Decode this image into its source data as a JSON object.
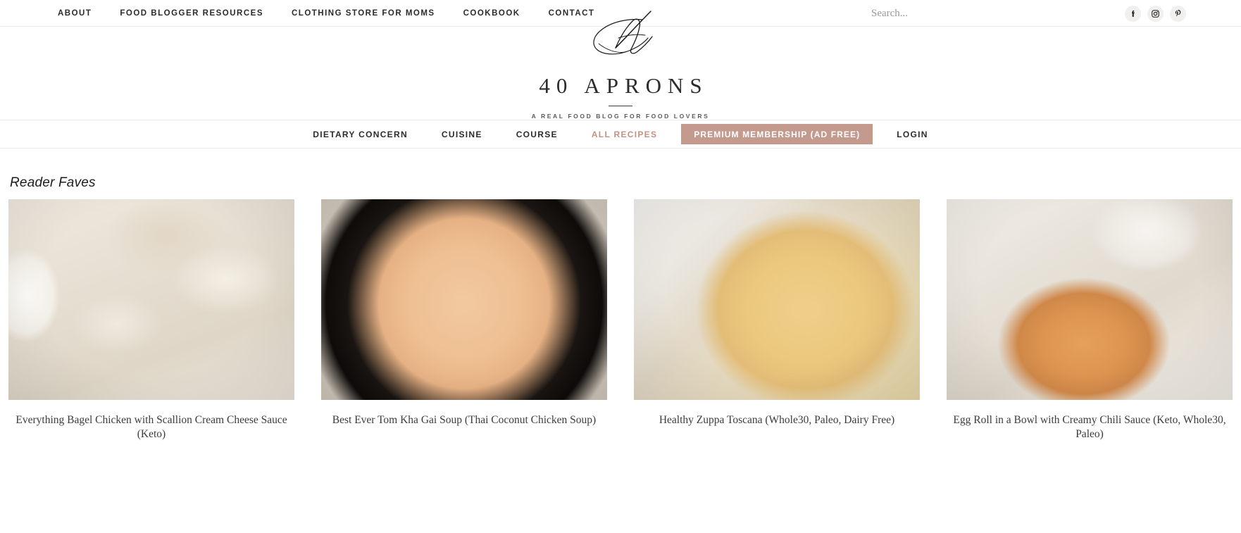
{
  "topbar": {
    "nav": [
      {
        "label": "ABOUT",
        "name": "about"
      },
      {
        "label": "FOOD BLOGGER RESOURCES",
        "name": "food-blogger-resources"
      },
      {
        "label": "CLOTHING STORE FOR MOMS",
        "name": "clothing-store-for-moms"
      },
      {
        "label": "COOKBOOK",
        "name": "cookbook"
      },
      {
        "label": "CONTACT",
        "name": "contact"
      }
    ],
    "search": {
      "placeholder": "Search...",
      "value": ""
    },
    "social": [
      {
        "label": "Facebook",
        "icon": "facebook-icon"
      },
      {
        "label": "Instagram",
        "icon": "instagram-icon"
      },
      {
        "label": "Pinterest",
        "icon": "pinterest-icon"
      }
    ]
  },
  "logo": {
    "monogram_icon": "script-monogram-icon",
    "name": "40 APRONS",
    "tagline": "A REAL FOOD BLOG FOR FOOD LOVERS"
  },
  "mainnav": {
    "items": [
      {
        "label": "DIETARY CONCERN",
        "name": "dietary-concern",
        "style": "default"
      },
      {
        "label": "CUISINE",
        "name": "cuisine",
        "style": "default"
      },
      {
        "label": "COURSE",
        "name": "course",
        "style": "default"
      },
      {
        "label": "ALL RECIPES",
        "name": "all-recipes",
        "style": "accent"
      },
      {
        "label": "PREMIUM MEMBERSHIP (AD FREE)",
        "name": "premium-membership",
        "style": "premium"
      },
      {
        "label": "LOGIN",
        "name": "login",
        "style": "default"
      }
    ]
  },
  "colors": {
    "premium_bg": "#c49a8e",
    "accent_text": "#c39183",
    "body_text": "#2b2b2b",
    "caption_text": "#3c3c3c",
    "divider": "#ececec",
    "social_bg": "#f2f0ed"
  },
  "main": {
    "section_title": "Reader Faves",
    "cards": [
      {
        "caption": "Everything Bagel Chicken with Scallion Cream Cheese Sauce (Keto)",
        "image_alt": "everything-bagel-chicken"
      },
      {
        "caption": "Best Ever Tom Kha Gai Soup (Thai Coconut Chicken Soup)",
        "image_alt": "tom-kha-gai-soup"
      },
      {
        "caption": "Healthy Zuppa Toscana (Whole30, Paleo, Dairy Free)",
        "image_alt": "zuppa-toscana"
      },
      {
        "caption": "Egg Roll in a Bowl with Creamy Chili Sauce (Keto, Whole30, Paleo)",
        "image_alt": "egg-roll-in-a-bowl"
      }
    ]
  }
}
